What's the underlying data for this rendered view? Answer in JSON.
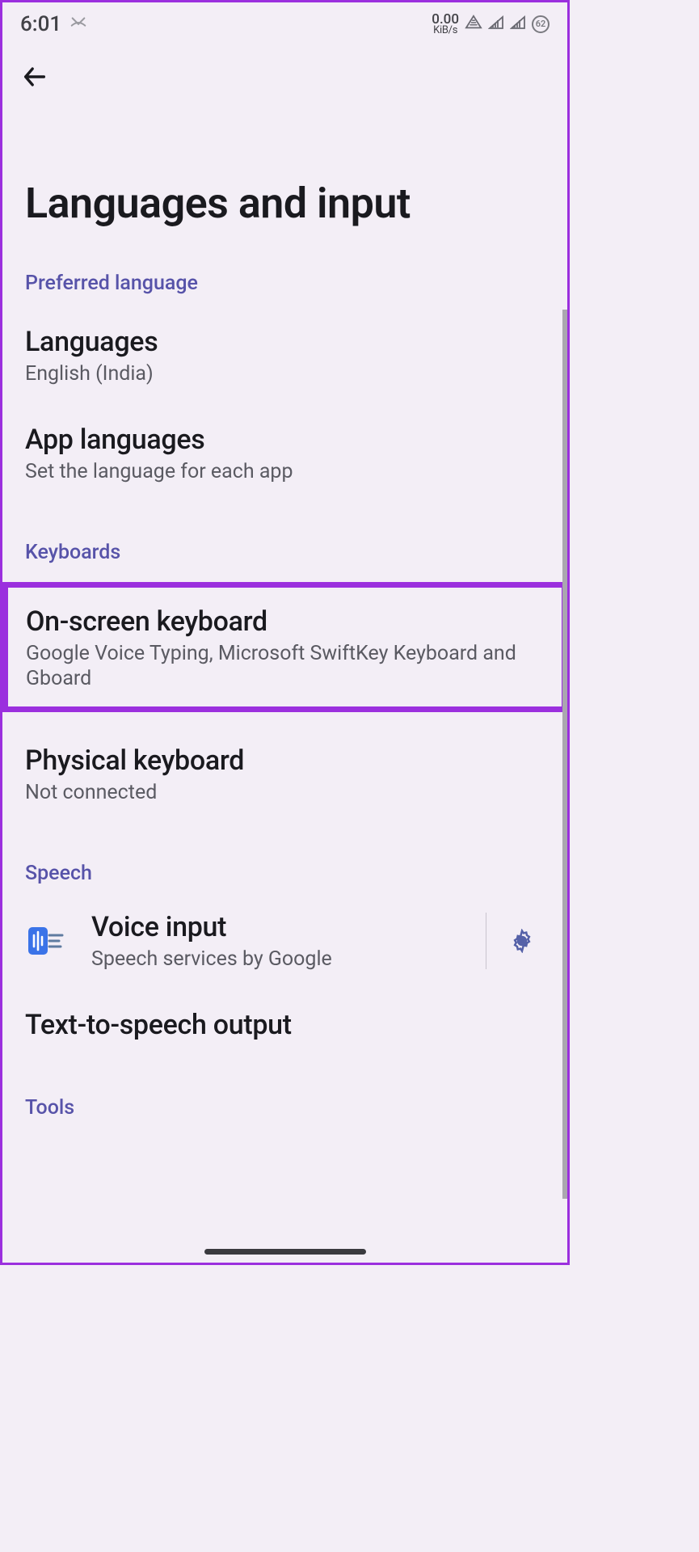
{
  "status": {
    "time": "6:01",
    "data_rate_value": "0.00",
    "data_rate_unit": "KiB/s",
    "battery": "62"
  },
  "page": {
    "title": "Languages and input"
  },
  "sections": {
    "preferred_language": {
      "header": "Preferred language",
      "languages": {
        "title": "Languages",
        "sub": "English (India)"
      },
      "app_languages": {
        "title": "App languages",
        "sub": "Set the language for each app"
      }
    },
    "keyboards": {
      "header": "Keyboards",
      "onscreen": {
        "title": "On-screen keyboard",
        "sub": "Google Voice Typing, Microsoft SwiftKey Keyboard and Gboard"
      },
      "physical": {
        "title": "Physical keyboard",
        "sub": "Not connected"
      }
    },
    "speech": {
      "header": "Speech",
      "voice_input": {
        "title": "Voice input",
        "sub": "Speech services by Google"
      },
      "tts": {
        "title": "Text-to-speech output"
      }
    },
    "tools": {
      "header": "Tools"
    }
  }
}
